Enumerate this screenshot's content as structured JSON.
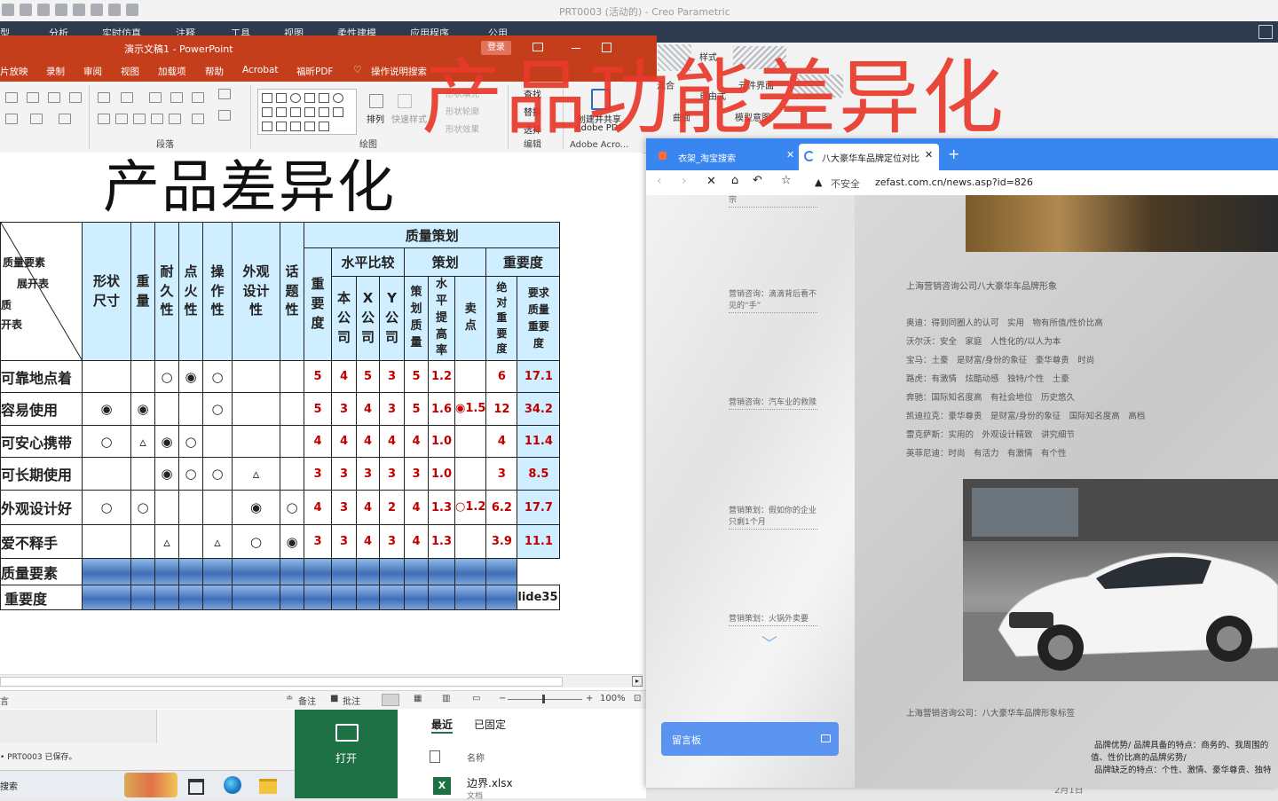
{
  "overlay": {
    "title": "产品功能差异化"
  },
  "creo": {
    "title": "PRT0003 (活动的) - Creo Parametric",
    "menu": [
      "型",
      "分析",
      "实时仿真",
      "注释",
      "工具",
      "视图",
      "柔性建模",
      "应用程序",
      "公用"
    ],
    "ribbon_labels": {
      "combine": "混合",
      "style": "样式",
      "freeform": "自由式",
      "freeform_ui": "元件界面",
      "curve": "曲面",
      "model_intent": "模型意图"
    }
  },
  "ppt": {
    "title": "演示文稿1 - PowerPoint",
    "login": "登录",
    "tabs": [
      "片放映",
      "录制",
      "审阅",
      "视图",
      "加载项",
      "帮助",
      "Acrobat",
      "福昕PDF",
      "操作说明搜索"
    ],
    "groups": {
      "paragraph": "段落",
      "drawing": "绘图",
      "edit": "编辑",
      "acrobat": "Adobe Acro..."
    },
    "ribbon": {
      "arrange": "排列",
      "quick_styles": "快速样式",
      "shape_fill": "形状填充",
      "shape_outline": "形状轮廓",
      "shape_effect": "形状效果",
      "find": "查找",
      "replace": "替换",
      "select": "选择",
      "create_share": "创建并共享",
      "adobe_pdf": "Adobe PDF"
    },
    "slide": {
      "title": "产品差异化",
      "table": {
        "corner": {
          "quality_elements": "质量要素",
          "deploy_table": "展开表",
          "quality": "质",
          "open_table": "开表"
        },
        "quality_header": "质量策划",
        "group_headers": {
          "level_compare": "水平比较",
          "planning": "策划",
          "importance": "重要度"
        },
        "col_headers": [
          "形状尺寸",
          "重量",
          "耐久性",
          "点火性",
          "操作性",
          "外观设计性",
          "话题性",
          "重要度",
          "本公司",
          "X公司",
          "Y公司",
          "策划质量",
          "水平提高率",
          "卖点",
          "绝对重要度",
          "要求质量重要度"
        ],
        "rows": [
          {
            "label": "可靠地点着",
            "marks": [
              "",
              "",
              "○",
              "◉",
              "○",
              "",
              ""
            ],
            "values": [
              "5",
              "4",
              "5",
              "3",
              "5",
              "1.2",
              "",
              "6",
              "17.1"
            ]
          },
          {
            "label": "容易使用",
            "marks": [
              "◉",
              "◉",
              "",
              "",
              "○",
              "",
              ""
            ],
            "values": [
              "5",
              "3",
              "4",
              "3",
              "5",
              "1.6",
              "◉1.5",
              "12",
              "34.2"
            ]
          },
          {
            "label": "可安心携带",
            "marks": [
              "○",
              "▵",
              "◉",
              "○",
              "",
              "",
              ""
            ],
            "values": [
              "4",
              "4",
              "4",
              "4",
              "4",
              "1.0",
              "",
              "4",
              "11.4"
            ]
          },
          {
            "label": "可长期使用",
            "marks": [
              "",
              "",
              "◉",
              "○",
              "○",
              "▵",
              ""
            ],
            "values": [
              "3",
              "3",
              "3",
              "3",
              "3",
              "1.0",
              "",
              "3",
              "8.5"
            ]
          },
          {
            "label": "外观设计好",
            "marks": [
              "○",
              "○",
              "",
              "",
              "",
              "◉",
              "○"
            ],
            "values": [
              "4",
              "3",
              "4",
              "2",
              "4",
              "1.3",
              "○1.2",
              "6.2",
              "17.7"
            ]
          },
          {
            "label": "爱不释手",
            "marks": [
              "",
              "",
              "▵",
              "",
              "▵",
              "○",
              "◉"
            ],
            "values": [
              "3",
              "3",
              "4",
              "3",
              "4",
              "1.3",
              "",
              "3.9",
              "11.1"
            ]
          }
        ],
        "footer_rows": [
          "质量要素",
          "重要度"
        ],
        "slide_tag": "lide35"
      }
    },
    "status": {
      "left": "言",
      "notes": "备注",
      "comments": "批注",
      "zoom": "100%"
    }
  },
  "bottom": {
    "save_msg": "PRT0003 已保存。",
    "search": "搜索",
    "excel_open": "打开",
    "recent_tab": "最近",
    "pinned_tab": "已固定",
    "name_header": "名称",
    "file_name": "边界.xlsx",
    "file_sub": "文档",
    "date_hint": "2月1日"
  },
  "browser": {
    "tabs": [
      {
        "title": "衣架_淘宝搜索",
        "active": false
      },
      {
        "title": "八大豪华车品牌定位对比",
        "active": true
      }
    ],
    "new_tab": "+",
    "insecure": "不安全",
    "url": "zefast.com.cn/news.asp?id=826",
    "side_links": [
      "营销咨询：滴滴背后看不见的“手”",
      "营销咨询：汽车业的救赎",
      "营销策划：假如你的企业只剩1个月",
      "营销策划：火锅外卖要"
    ],
    "side_top": "宗",
    "section_title": "上海营销咨询公司八大豪华车品牌形象",
    "brands": [
      "奥迪：得到同圈人的认可　实用　物有所值/性价比高",
      "沃尔沃：安全　家庭　人性化的/以人为本",
      "宝马：土豪　是财富/身份的象征　豪华尊贵　时尚",
      "路虎：有激情　炫酷动感　独特/个性　土豪",
      "奔驰：国际知名度高　有社会地位　历史悠久",
      "凯迪拉克：豪华尊贵　是财富/身份的象征　国际知名度高　高档",
      "雷克萨斯：实用的　外观设计精致　讲究细节",
      "英菲尼迪：时尚　有活力　有激情　有个性"
    ],
    "footer_title": "上海营销咨询公司：八大豪华车品牌形象标签",
    "footer_text1": "品牌优势/ 品牌具备的特点：商务的、我周围的",
    "footer_text2": "值、性价比高的品牌劣势/",
    "footer_text3": "品牌缺乏的特点：个性、激情、豪华尊贵、独特",
    "guestbook": "留言板"
  }
}
